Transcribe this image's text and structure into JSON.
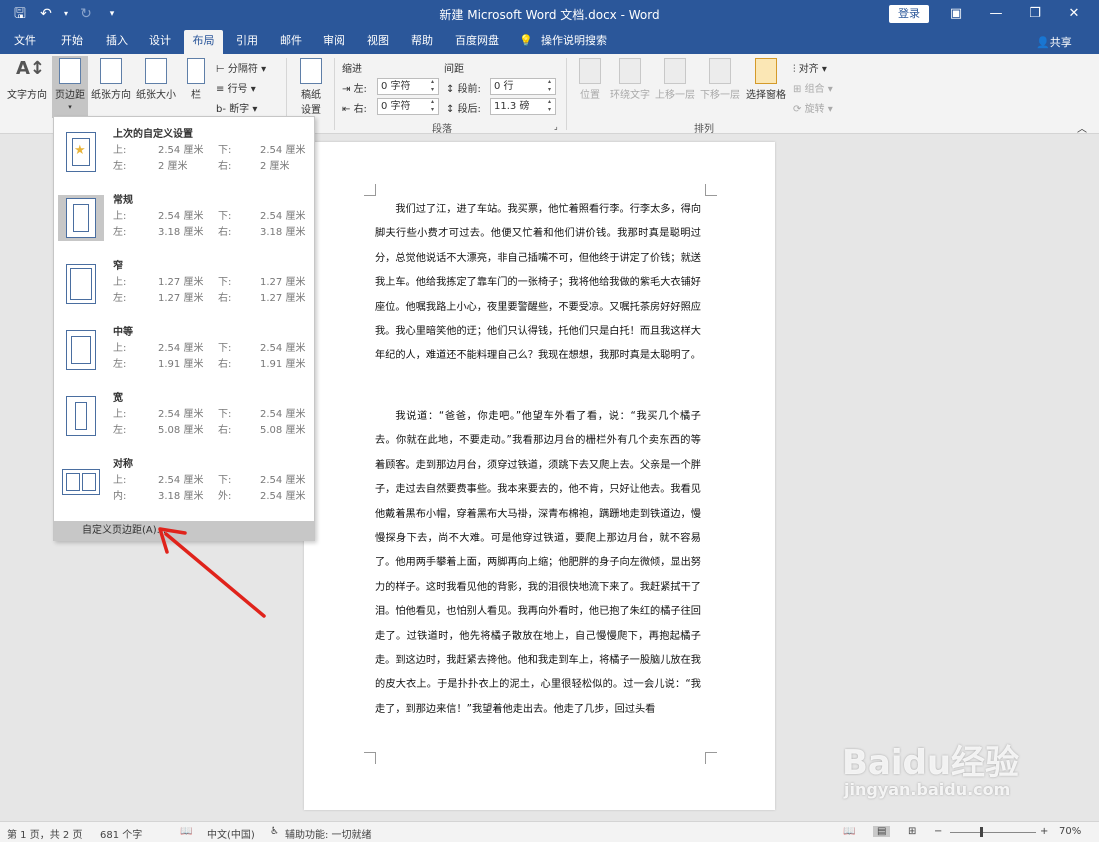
{
  "title_bar": {
    "doc_title": "新建 Microsoft Word 文档.docx - Word",
    "signin_label": "登录"
  },
  "tabs": [
    "文件",
    "开始",
    "插入",
    "设计",
    "布局",
    "引用",
    "邮件",
    "审阅",
    "视图",
    "帮助",
    "百度网盘",
    "操作说明搜索"
  ],
  "active_tab": "布局",
  "share_label": "共享",
  "ribbon": {
    "page_setup": {
      "text_direction": "文字方向",
      "margins": "页边距",
      "orientation": "纸张方向",
      "size": "纸张大小",
      "columns": "栏",
      "breaks": "分隔符",
      "line_numbers": "行号",
      "hyphenation": "断字"
    },
    "draft": {
      "label_line1": "稿纸",
      "label_line2": "设置"
    },
    "paragraph": {
      "indent_header": "缩进",
      "spacing_header": "间距",
      "left_label": "左:",
      "right_label": "右:",
      "left_value": "0 字符",
      "right_value": "0 字符",
      "before_label": "段前:",
      "after_label": "段后:",
      "before_value": "0 行",
      "after_value": "11.3 磅",
      "group_label": "段落"
    },
    "arrange": {
      "position": "位置",
      "wrap_text": "环绕文字",
      "bring_forward": "上移一层",
      "send_backward": "下移一层",
      "selection_pane": "选择窗格",
      "align": "对齐",
      "group": "组合",
      "rotate": "旋转",
      "group_label": "排列"
    }
  },
  "margins_menu": {
    "options": [
      {
        "name": "上次的自定义设置",
        "k1": "上:",
        "v1": "2.54 厘米",
        "k2": "下:",
        "v2": "2.54 厘米",
        "k3": "左:",
        "v3": "2 厘米",
        "k4": "右:",
        "v4": "2 厘米"
      },
      {
        "name": "常规",
        "k1": "上:",
        "v1": "2.54 厘米",
        "k2": "下:",
        "v2": "2.54 厘米",
        "k3": "左:",
        "v3": "3.18 厘米",
        "k4": "右:",
        "v4": "3.18 厘米"
      },
      {
        "name": "窄",
        "k1": "上:",
        "v1": "1.27 厘米",
        "k2": "下:",
        "v2": "1.27 厘米",
        "k3": "左:",
        "v3": "1.27 厘米",
        "k4": "右:",
        "v4": "1.27 厘米"
      },
      {
        "name": "中等",
        "k1": "上:",
        "v1": "2.54 厘米",
        "k2": "下:",
        "v2": "2.54 厘米",
        "k3": "左:",
        "v3": "1.91 厘米",
        "k4": "右:",
        "v4": "1.91 厘米"
      },
      {
        "name": "宽",
        "k1": "上:",
        "v1": "2.54 厘米",
        "k2": "下:",
        "v2": "2.54 厘米",
        "k3": "左:",
        "v3": "5.08 厘米",
        "k4": "右:",
        "v4": "5.08 厘米"
      },
      {
        "name": "对称",
        "k1": "上:",
        "v1": "2.54 厘米",
        "k2": "下:",
        "v2": "2.54 厘米",
        "k3": "内:",
        "v3": "3.18 厘米",
        "k4": "外:",
        "v4": "2.54 厘米"
      }
    ],
    "custom_label": "自定义页边距(A)..."
  },
  "document": {
    "paragraph1": "我们过了江，进了车站。我买票，他忙着照看行李。行李太多，得向脚夫行些小费才可过去。他便又忙着和他们讲价钱。我那时真是聪明过分，总觉他说话不大漂亮，非自己插嘴不可，但他终于讲定了价钱；就送我上车。他给我拣定了靠车门的一张椅子；我将他给我做的紫毛大衣铺好座位。他嘱我路上小心，夜里要警醒些，不要受凉。又嘱托茶房好好照应我。我心里暗笑他的迂；他们只认得钱，托他们只是白托！而且我这样大年纪的人，难道还不能料理自己么？我现在想想，我那时真是太聪明了。",
    "paragraph2": "我说道：“爸爸，你走吧。”他望车外看了看，说：“我买几个橘子去。你就在此地，不要走动。”我看那边月台的栅栏外有几个卖东西的等着顾客。走到那边月台，须穿过铁道，须跳下去又爬上去。父亲是一个胖子，走过去自然要费事些。我本来要去的，他不肯，只好让他去。我看见他戴着黑布小帽，穿着黑布大马褂，深青布棉袍，蹒跚地走到铁道边，慢慢探身下去，尚不大难。可是他穿过铁道，要爬上那边月台，就不容易了。他用两手攀着上面，两脚再向上缩；他肥胖的身子向左微倾，显出努力的样子。这时我看见他的背影，我的泪很快地流下来了。我赶紧拭干了泪。怕他看见，也怕别人看见。我再向外看时，他已抱了朱红的橘子往回走了。过铁道时，他先将橘子散放在地上，自己慢慢爬下，再抱起橘子走。到这边时，我赶紧去搀他。他和我走到车上，将橘子一股脑儿放在我的皮大衣上。于是扑扑衣上的泥土，心里很轻松似的。过一会儿说：“我走了，到那边来信！”我望着他走出去。他走了几步，回过头看"
  },
  "status_bar": {
    "page_info": "第 1 页，共 2 页",
    "word_count": "681 个字",
    "language": "中文(中国)",
    "accessibility": "辅助功能: 一切就绪",
    "zoom": "70%"
  },
  "watermark": {
    "main": "Baidu经验",
    "sub": "jingyan.baidu.com"
  },
  "colors": {
    "brand": "#2b579a",
    "annotation_arrow": "#e0231b"
  }
}
